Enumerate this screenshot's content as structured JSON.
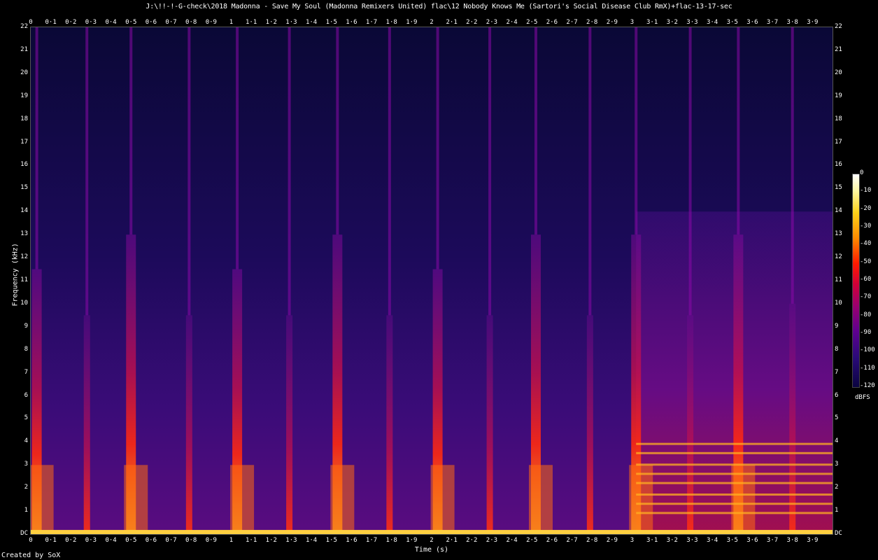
{
  "title": "J:\\!!-!-G-check\\2018 Madonna - Save My Soul (Madonna Remixers United) flac\\12 Nobody Knows Me (Sartori's Social Disease Club RmX)+flac-13-17-sec",
  "credit": "Created by SoX",
  "chart_data": {
    "type": "heatmap",
    "title": "J:\\!!-!-G-check\\2018 Madonna - Save My Soul (Madonna Remixers United) flac\\12 Nobody Knows Me (Sartori's Social Disease Club RmX)+flac-13-17-sec",
    "xlabel": "Time (s)",
    "ylabel": "Frequency (kHz)",
    "xlim": [
      0,
      4
    ],
    "ylim": [
      0,
      22
    ],
    "x_ticks": [
      "0",
      "0·1",
      "0·2",
      "0·3",
      "0·4",
      "0·5",
      "0·6",
      "0·7",
      "0·8",
      "0·9",
      "1",
      "1·1",
      "1·2",
      "1·3",
      "1·4",
      "1·5",
      "1·6",
      "1·7",
      "1·8",
      "1·9",
      "2",
      "2·1",
      "2·2",
      "2·3",
      "2·4",
      "2·5",
      "2·6",
      "2·7",
      "2·8",
      "2·9",
      "3",
      "3·1",
      "3·2",
      "3·3",
      "3·4",
      "3·5",
      "3·6",
      "3·7",
      "3·8",
      "3·9"
    ],
    "y_ticks": [
      "DC",
      "1",
      "2",
      "3",
      "4",
      "5",
      "6",
      "7",
      "8",
      "9",
      "10",
      "11",
      "12",
      "13",
      "14",
      "15",
      "16",
      "17",
      "18",
      "19",
      "20",
      "21",
      "22"
    ],
    "colorbar": {
      "label": "dBFS",
      "range": [
        -120,
        0
      ],
      "ticks": [
        "0",
        "-10",
        "-20",
        "-30",
        "-40",
        "-50",
        "-60",
        "-70",
        "-80",
        "-90",
        "-100",
        "-110",
        "-120"
      ]
    },
    "transients": [
      {
        "t": 0.03,
        "top_khz": 11.5,
        "strength": 1.0,
        "low": true
      },
      {
        "t": 0.28,
        "top_khz": 9.5,
        "strength": 0.7,
        "low": false
      },
      {
        "t": 0.5,
        "top_khz": 13,
        "strength": 1.0,
        "low": true
      },
      {
        "t": 0.79,
        "top_khz": 9.5,
        "strength": 0.7,
        "low": false
      },
      {
        "t": 1.03,
        "top_khz": 11.5,
        "strength": 1.0,
        "low": true
      },
      {
        "t": 1.29,
        "top_khz": 9.5,
        "strength": 0.7,
        "low": false
      },
      {
        "t": 1.53,
        "top_khz": 13,
        "strength": 1.0,
        "low": true
      },
      {
        "t": 1.79,
        "top_khz": 9.5,
        "strength": 0.7,
        "low": false
      },
      {
        "t": 2.03,
        "top_khz": 11.5,
        "strength": 1.0,
        "low": true
      },
      {
        "t": 2.29,
        "top_khz": 9.5,
        "strength": 0.7,
        "low": false
      },
      {
        "t": 2.52,
        "top_khz": 13,
        "strength": 1.0,
        "low": true
      },
      {
        "t": 2.79,
        "top_khz": 9.5,
        "strength": 0.7,
        "low": false
      },
      {
        "t": 3.02,
        "top_khz": 13,
        "strength": 1.0,
        "low": true
      },
      {
        "t": 3.29,
        "top_khz": 9.5,
        "strength": 0.7,
        "low": false
      },
      {
        "t": 3.53,
        "top_khz": 13,
        "strength": 1.0,
        "low": true
      },
      {
        "t": 3.8,
        "top_khz": 10,
        "strength": 0.7,
        "low": false
      }
    ],
    "tonal_region": {
      "t_start": 3.02,
      "t_end": 4.0,
      "harmonics_khz": [
        0.9,
        1.3,
        1.7,
        2.2,
        2.6,
        3.0,
        3.5,
        3.9
      ]
    }
  }
}
